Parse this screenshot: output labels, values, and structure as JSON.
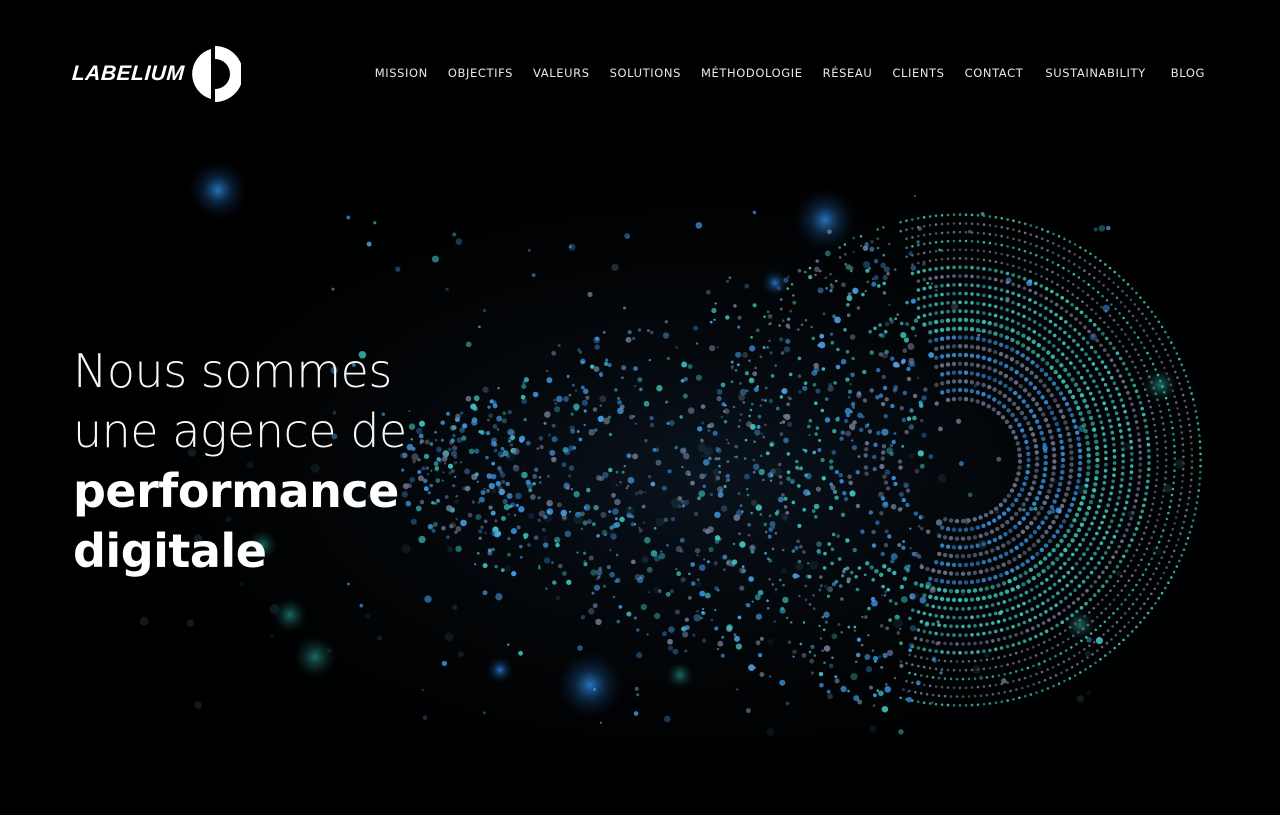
{
  "brand": {
    "name": "LABELIUM",
    "logo_icon": "labelium-d-mark-icon"
  },
  "nav": {
    "items": [
      {
        "label": "MISSION"
      },
      {
        "label": "OBJECTIFS"
      },
      {
        "label": "VALEURS"
      },
      {
        "label": "SOLUTIONS"
      },
      {
        "label": "MÉTHODOLOGIE"
      },
      {
        "label": "RÉSEAU"
      },
      {
        "label": "CLIENTS"
      },
      {
        "label": "CONTACT"
      },
      {
        "label": "SUSTAINABILITY"
      },
      {
        "label": "BLOG"
      }
    ]
  },
  "hero": {
    "line1": "Nous sommes",
    "line2": "une agence de",
    "line3": "performance",
    "line4": "digitale",
    "art_icon": "particle-swirl-illustration"
  },
  "colors": {
    "background": "#000000",
    "text": "#ffffff",
    "particle_blue": "#3a8fd9",
    "particle_teal": "#3fc7c0",
    "particle_gray": "#6c7890"
  }
}
